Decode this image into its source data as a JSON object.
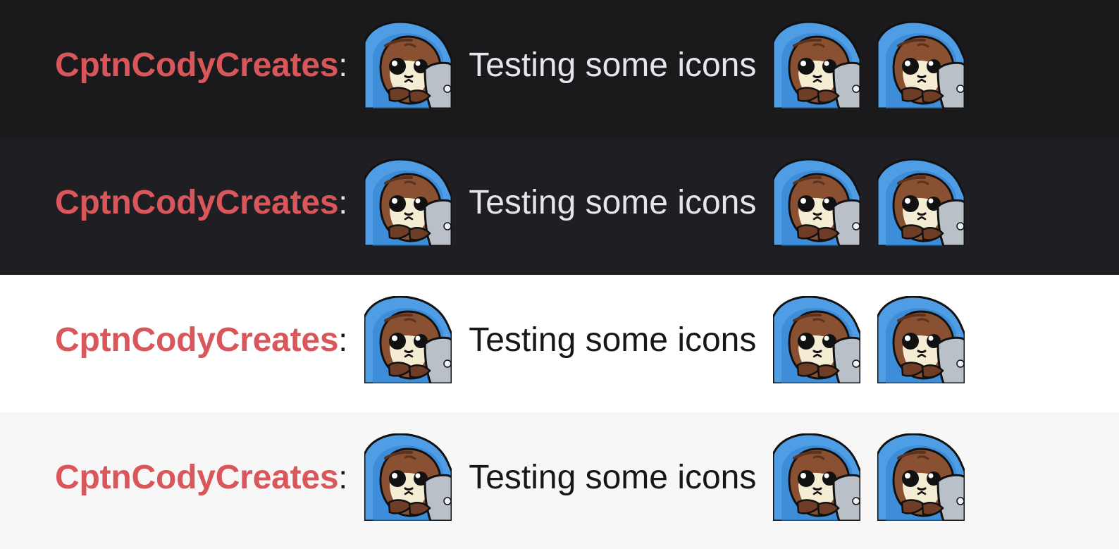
{
  "theme": {
    "username_color": "#d9575a"
  },
  "emote": {
    "icon": "otter-laptop-icon"
  },
  "rows": [
    {
      "background": "#1a191c",
      "text_color": "#e6e6ea",
      "username": "CptnCodyCreates",
      "separator": ":",
      "message": "Testing some icons"
    },
    {
      "background": "#1f1e23",
      "text_color": "#e6e6ea",
      "username": "CptnCodyCreates",
      "separator": ":",
      "message": "Testing some icons"
    },
    {
      "background": "#ffffff",
      "text_color": "#17161a",
      "username": "CptnCodyCreates",
      "separator": ":",
      "message": "Testing some icons"
    },
    {
      "background": "#f7f7f8",
      "text_color": "#17161a",
      "username": "CptnCodyCreates",
      "separator": ":",
      "message": "Testing some icons"
    }
  ]
}
